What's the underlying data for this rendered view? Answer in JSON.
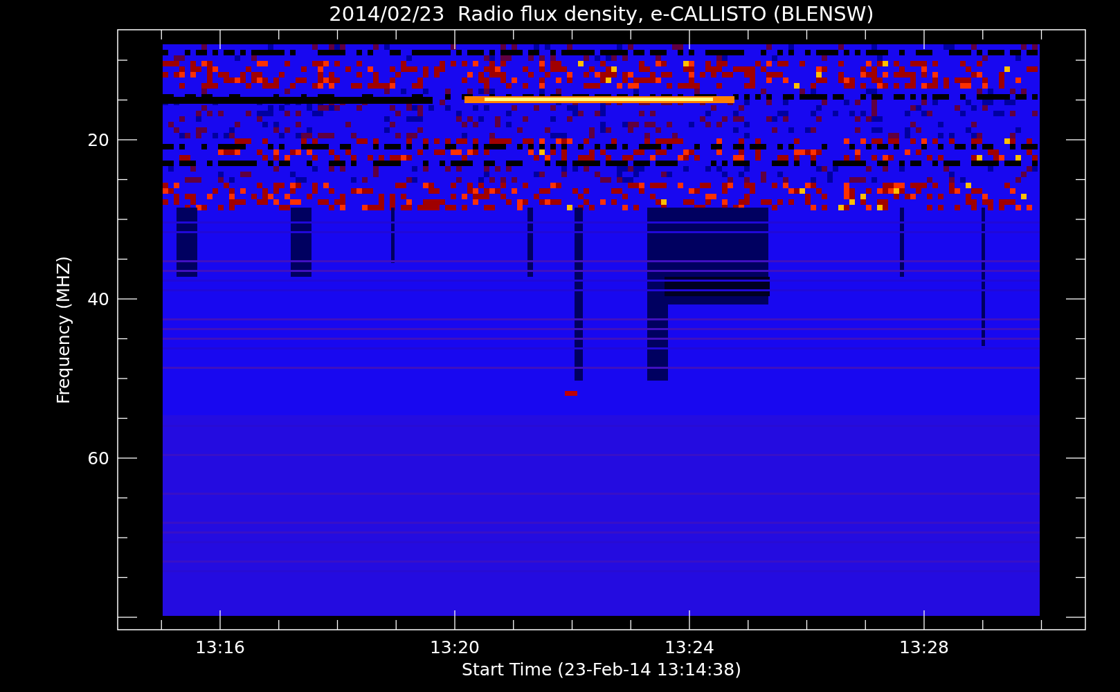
{
  "title": "2014/02/23  Radio flux density, e-CALLISTO (BLENSW)",
  "y_axis": {
    "label": "Frequency (MHZ)",
    "tick_labels": [
      "20",
      "40",
      "60"
    ]
  },
  "x_axis": {
    "label": "Start Time (23-Feb-14 13:14:38)",
    "tick_labels": [
      "13:16",
      "13:20",
      "13:24",
      "13:28"
    ]
  }
}
